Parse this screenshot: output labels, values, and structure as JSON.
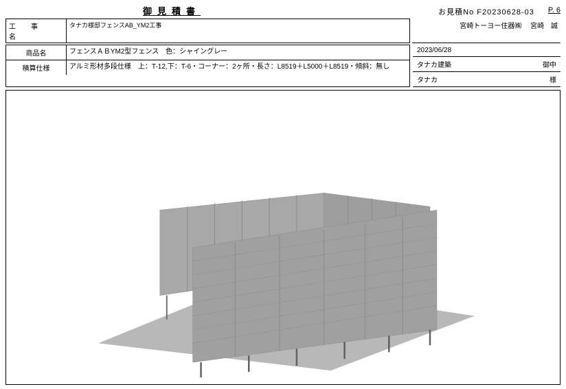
{
  "header": {
    "title": "御見積書",
    "quote_no_label": "お見積No",
    "quote_no": "F20230628-03",
    "page_label": "P. 6"
  },
  "project": {
    "label": "工　事　名",
    "value": "タナカ様邸フェンスAB_YM2工事"
  },
  "company_line": {
    "name": "宮崎トーヨー住器㈱",
    "person": "宮崎　誠"
  },
  "product": {
    "label": "商品名",
    "value": "フェンスＡＢYM2型フェンス　色：シャイングレー"
  },
  "spec": {
    "label": "積算仕様",
    "value": "アルミ形材多段仕様　上：T-12,下：T-6・コーナー：2ヶ所・長さ：L8519＋L5000＋L8519・傾斜：無し"
  },
  "right_rows": {
    "date": "2023/06/28",
    "builder": "タナカ建築",
    "builder_suffix": "御中",
    "customer": "タナカ",
    "customer_suffix": "様"
  }
}
